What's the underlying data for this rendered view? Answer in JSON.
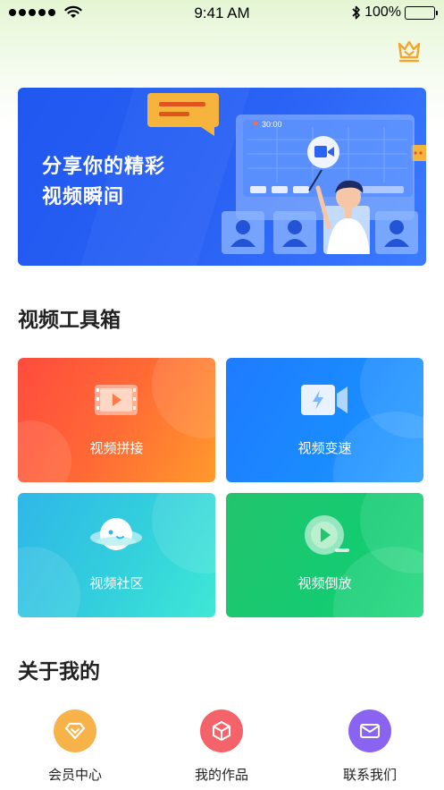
{
  "status_bar": {
    "time": "9:41 AM",
    "battery": "100%",
    "signal_icon": "signal-dots-icon",
    "wifi_icon": "wifi-icon",
    "bluetooth_icon": "bluetooth-icon"
  },
  "header": {
    "crown_icon": "crown-icon",
    "crown_color": "#f4a62a"
  },
  "banner": {
    "title_line1": "分享你的精彩",
    "title_line2": "视频瞬间",
    "screen_time": "30:00",
    "background": "#2560f4"
  },
  "toolbox": {
    "title": "视频工具箱",
    "items": [
      {
        "label": "视频拼接",
        "icon": "film-strip-icon",
        "color": "#ff5a3a"
      },
      {
        "label": "视频变速",
        "icon": "video-camera-speed-icon",
        "color": "#1e82ff"
      },
      {
        "label": "视频社区",
        "icon": "planet-icon",
        "color": "#34c9e0"
      },
      {
        "label": "视频倒放",
        "icon": "play-circle-icon",
        "color": "#1ec872"
      }
    ]
  },
  "about": {
    "title": "关于我的",
    "items": [
      {
        "label": "会员中心",
        "icon": "diamond-icon",
        "color": "#f7b24a"
      },
      {
        "label": "我的作品",
        "icon": "box-icon",
        "color": "#f5636a"
      },
      {
        "label": "联系我们",
        "icon": "mail-icon",
        "color": "#8a63f0"
      }
    ]
  }
}
